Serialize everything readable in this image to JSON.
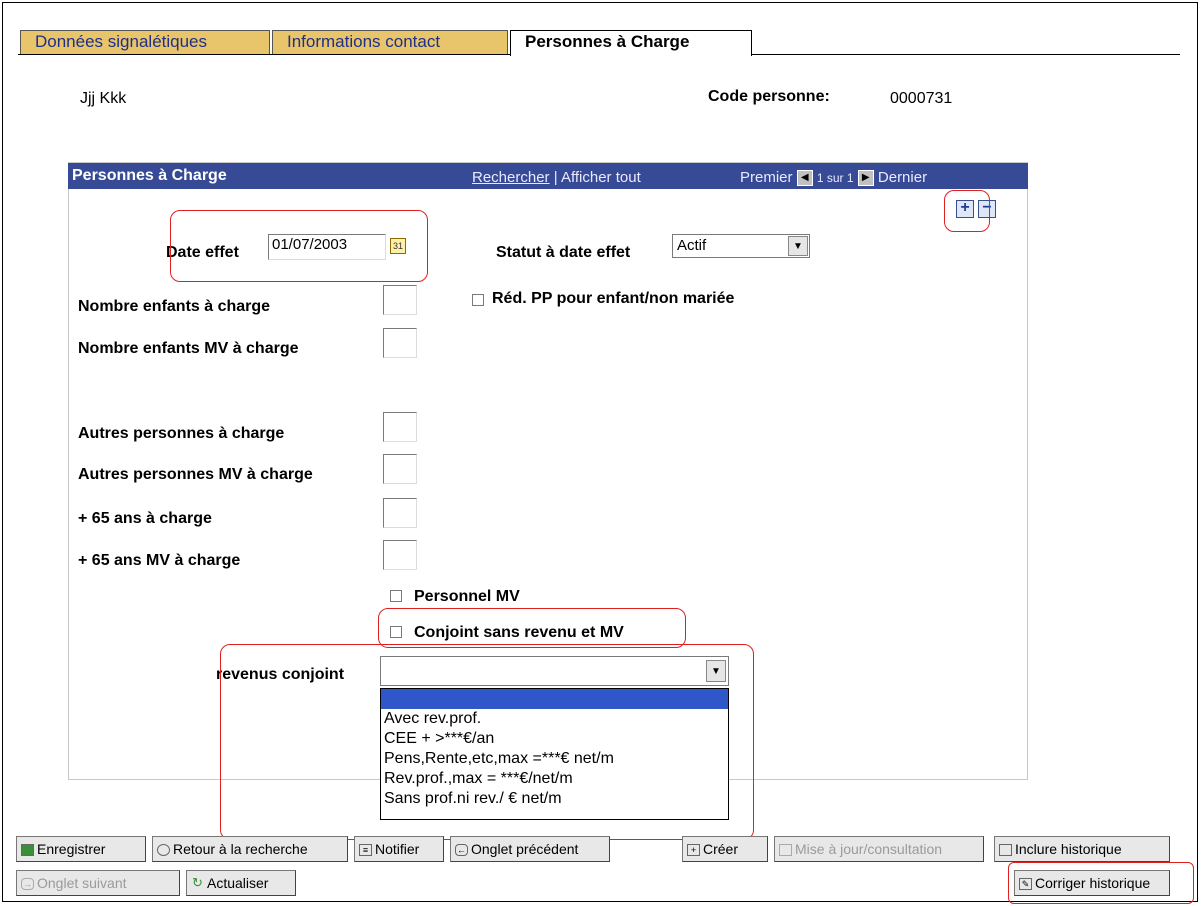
{
  "tabs": [
    {
      "label": "Données signalétiques",
      "active": false
    },
    {
      "label": "Informations contact",
      "active": false
    },
    {
      "label": "Personnes à Charge",
      "active": true
    }
  ],
  "person": {
    "name": "Jjj Kkk",
    "code_label": "Code personne:",
    "code_value": "0000731"
  },
  "grid": {
    "title": "Personnes à Charge",
    "search_link": "Rechercher",
    "separator": "|",
    "show_all": "Afficher tout",
    "first": "Premier",
    "counter": "1 sur 1",
    "last": "Dernier"
  },
  "fields": {
    "date_effet_label": "Date effet",
    "date_effet_value": "01/07/2003",
    "statut_label": "Statut à date effet",
    "statut_value": "Actif",
    "nb_enfants_label": "Nombre enfants à charge",
    "red_pp_label": "Réd. PP pour enfant/non mariée",
    "nb_enfants_mv_label": "Nombre enfants MV à charge",
    "autres_label": "Autres personnes à charge",
    "autres_mv_label": "Autres personnes MV à charge",
    "plus65_label": "+ 65 ans à charge",
    "plus65_mv_label": "+ 65 ans MV à charge",
    "personnel_mv_label": "Personnel MV",
    "conjoint_label": "Conjoint sans revenu et MV",
    "revenus_label": "revenus conjoint",
    "revenus_value": ""
  },
  "revenus_options": [
    "",
    "Avec rev.prof.",
    "CEE + >***€/an",
    "Pens,Rente,etc,max =***€ net/m",
    "Rev.prof.,max = ***€/net/m",
    "Sans prof.ni rev./ € net/m"
  ],
  "buttons": {
    "save": "Enregistrer",
    "back": "Retour à la recherche",
    "notify": "Notifier",
    "prev_tab": "Onglet précédent",
    "create": "Créer",
    "update": "Mise à jour/consultation",
    "include_history": "Inclure historique",
    "next_tab": "Onglet suivant",
    "refresh": "Actualiser",
    "correct_history": "Corriger historique"
  },
  "colors": {
    "tab_inactive": "#e8c46a",
    "grid_header": "#364a96",
    "highlight": "#e02020",
    "selected_option": "#2f57c9"
  },
  "icons": {
    "add": "+",
    "remove": "−",
    "calendar": "31",
    "dropdown": "▼"
  }
}
